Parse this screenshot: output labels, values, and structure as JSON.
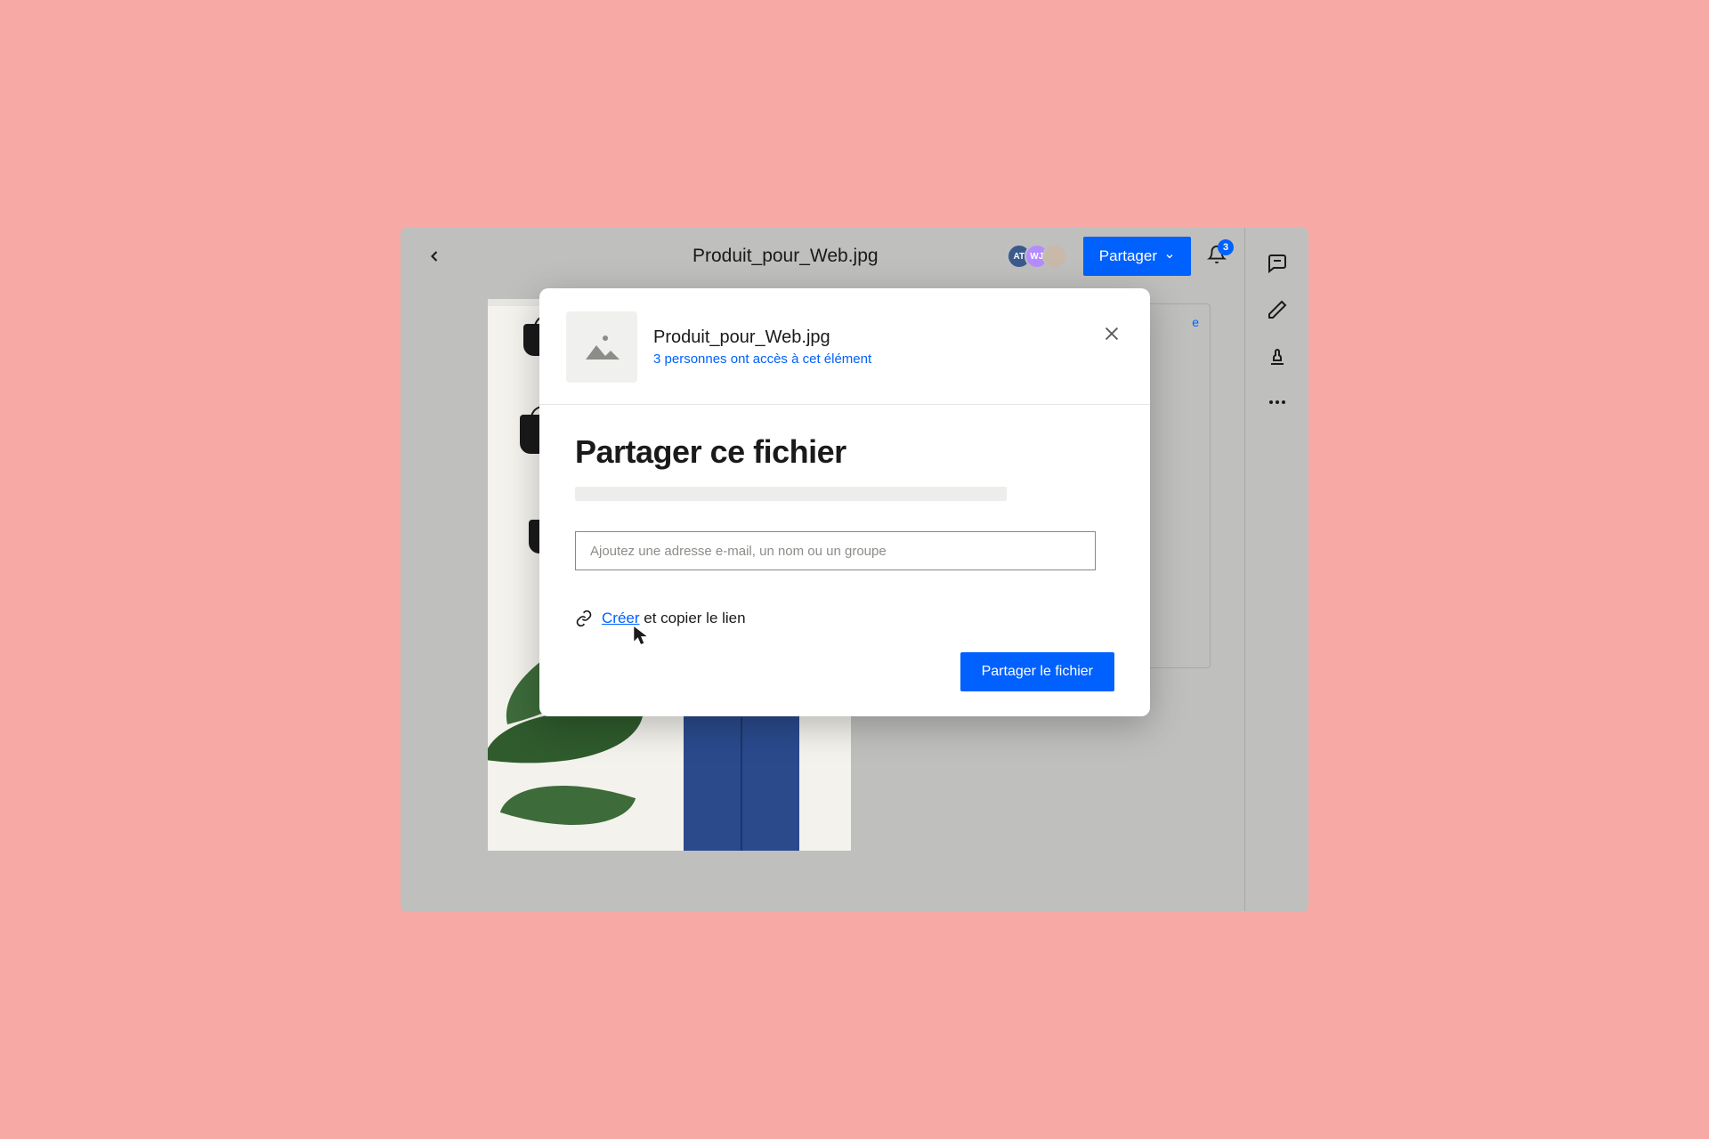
{
  "header": {
    "filename": "Produit_pour_Web.jpg",
    "share_button": "Partager",
    "notification_count": "3",
    "avatars": [
      {
        "initials": "AT",
        "bg": "#3a5a8c"
      },
      {
        "initials": "WJ",
        "bg": "#b48cff"
      },
      {
        "initials": "",
        "bg": "#c9b9a8"
      }
    ]
  },
  "modal": {
    "filename": "Produit_pour_Web.jpg",
    "access_summary": "3 personnes ont accès à cet élément",
    "title": "Partager ce fichier",
    "email_placeholder": "Ajoutez une adresse e-mail, un nom ou un groupe",
    "create_link_action": "Créer",
    "create_link_rest": " et copier le lien",
    "share_file_button": "Partager le fichier"
  }
}
